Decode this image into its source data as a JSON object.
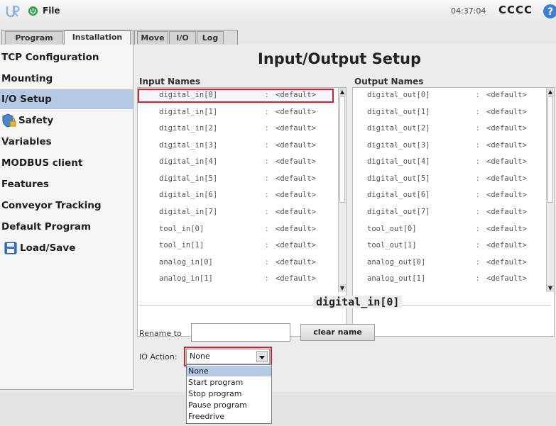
{
  "header": {
    "file_menu": "File",
    "clock": "04:37:04",
    "robot_name": "CCCC"
  },
  "tabs": {
    "program": "Program",
    "installation": "Installation",
    "move": "Move",
    "io": "I/O",
    "log": "Log"
  },
  "sidebar": {
    "items": [
      {
        "label": "TCP Configuration"
      },
      {
        "label": "Mounting"
      },
      {
        "label": "I/O Setup"
      },
      {
        "label": "Safety"
      },
      {
        "label": "Variables"
      },
      {
        "label": "MODBUS client"
      },
      {
        "label": "Features"
      },
      {
        "label": "Conveyor Tracking"
      },
      {
        "label": "Default Program"
      },
      {
        "label": "Load/Save"
      }
    ]
  },
  "main": {
    "title": "Input/Output Setup",
    "inputs_heading": "Input Names",
    "outputs_heading": "Output Names",
    "separator": ":",
    "inputs": [
      {
        "name": "digital_in[0]",
        "value": "<default>"
      },
      {
        "name": "digital_in[1]",
        "value": "<default>"
      },
      {
        "name": "digital_in[2]",
        "value": "<default>"
      },
      {
        "name": "digital_in[3]",
        "value": "<default>"
      },
      {
        "name": "digital_in[4]",
        "value": "<default>"
      },
      {
        "name": "digital_in[5]",
        "value": "<default>"
      },
      {
        "name": "digital_in[6]",
        "value": "<default>"
      },
      {
        "name": "digital_in[7]",
        "value": "<default>"
      },
      {
        "name": "tool_in[0]",
        "value": "<default>"
      },
      {
        "name": "tool_in[1]",
        "value": "<default>"
      },
      {
        "name": "analog_in[0]",
        "value": "<default>"
      },
      {
        "name": "analog_in[1]",
        "value": "<default>"
      }
    ],
    "outputs": [
      {
        "name": "digital_out[0]",
        "value": "<default>"
      },
      {
        "name": "digital_out[1]",
        "value": "<default>"
      },
      {
        "name": "digital_out[2]",
        "value": "<default>"
      },
      {
        "name": "digital_out[3]",
        "value": "<default>"
      },
      {
        "name": "digital_out[4]",
        "value": "<default>"
      },
      {
        "name": "digital_out[5]",
        "value": "<default>"
      },
      {
        "name": "digital_out[6]",
        "value": "<default>"
      },
      {
        "name": "digital_out[7]",
        "value": "<default>"
      },
      {
        "name": "tool_out[0]",
        "value": "<default>"
      },
      {
        "name": "tool_out[1]",
        "value": "<default>"
      },
      {
        "name": "analog_out[0]",
        "value": "<default>"
      },
      {
        "name": "analog_out[1]",
        "value": "<default>"
      }
    ]
  },
  "detail": {
    "title": "digital_in[0]",
    "rename_label": "Rename to",
    "rename_value": "",
    "clear_button": "clear name",
    "io_action_label": "IO Action:",
    "io_action_value": "None",
    "io_action_options": [
      "None",
      "Start program",
      "Stop program",
      "Pause program",
      "Freedrive"
    ]
  },
  "colors": {
    "selection": "#b5c9e4",
    "highlight_outline": "#c9252c",
    "help_icon": "#3d7fd6",
    "power_icon": "#2e9e3e"
  }
}
